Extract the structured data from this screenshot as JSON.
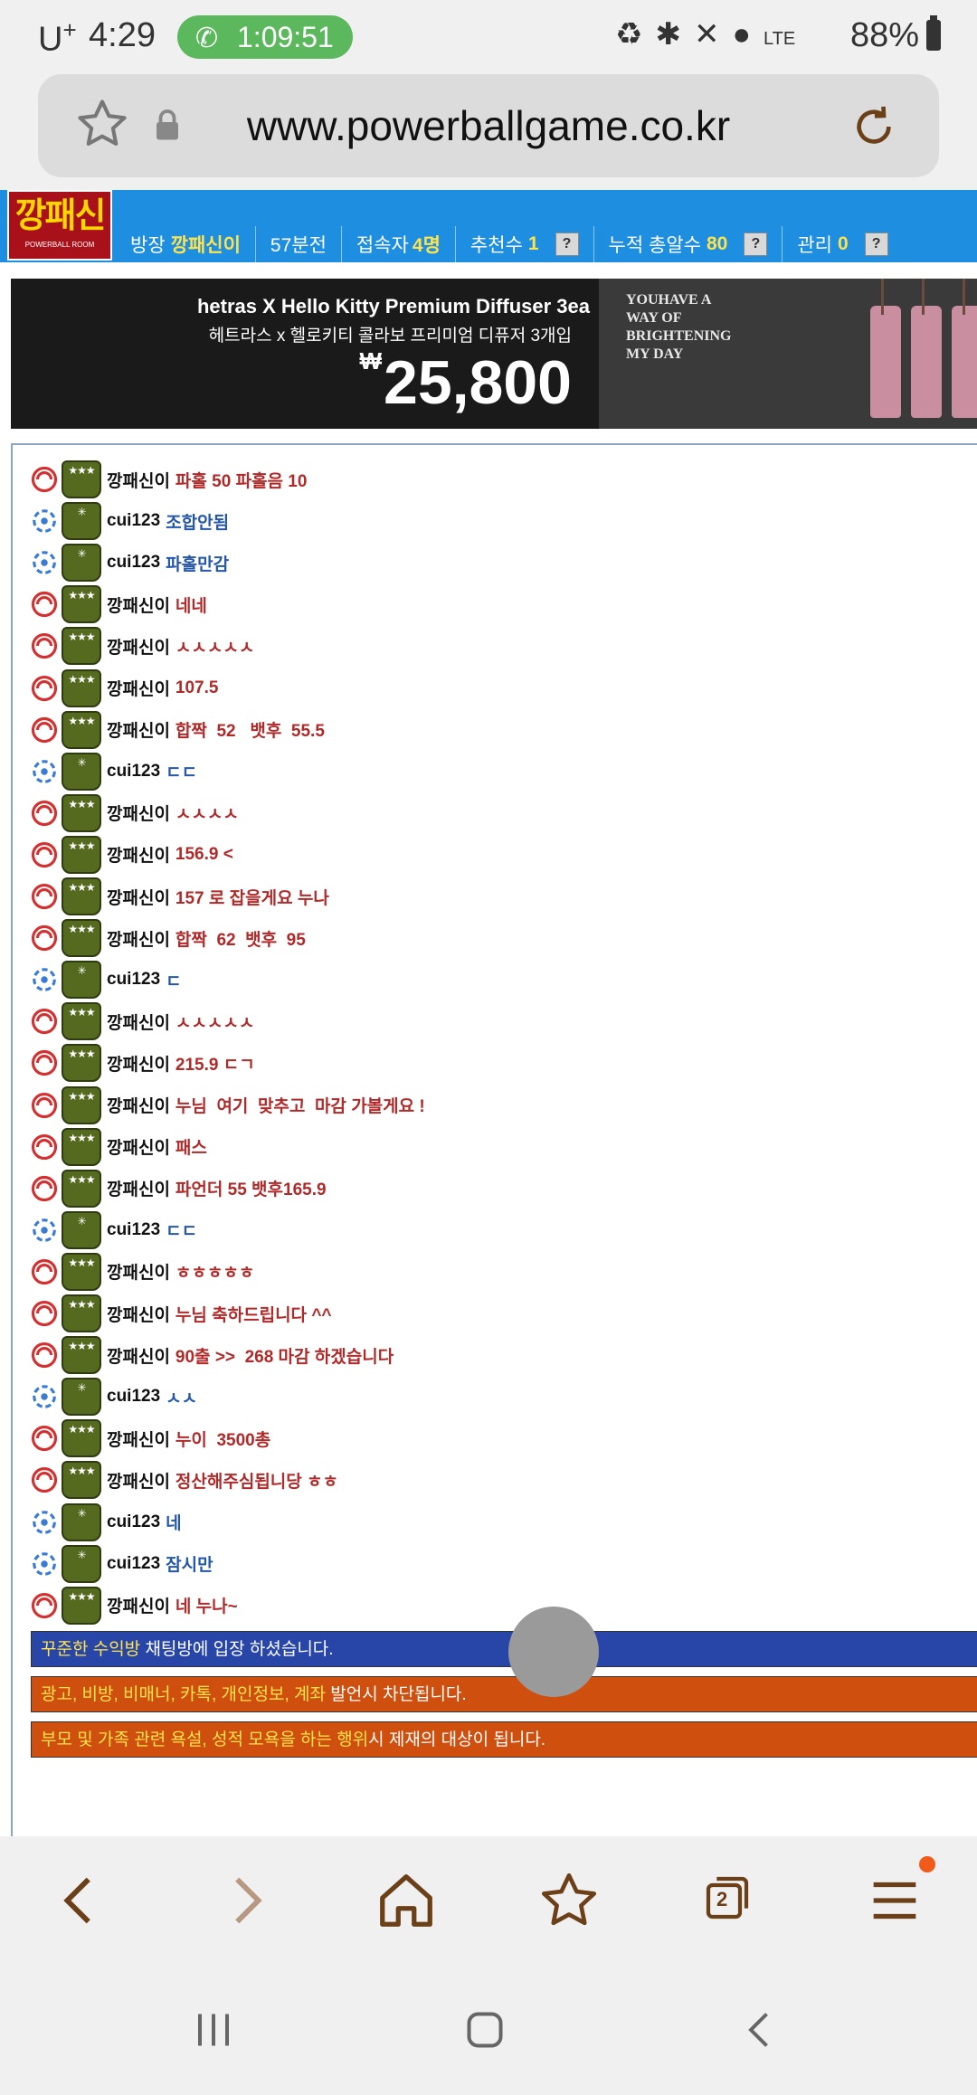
{
  "status_bar": {
    "carrier": "U",
    "carrier_sup": "+",
    "time": "4:29",
    "call_timer": "1:09:51",
    "network": "LTE",
    "battery": "88%"
  },
  "browser": {
    "url": "www.powerballgame.co.kr",
    "tab_count": "2"
  },
  "room": {
    "logo_text": "깡패신",
    "logo_sub": "POWERBALL ROOM",
    "owner_label": "방장",
    "owner_name": "깡패신이",
    "elapsed": "57분전",
    "visitors_label": "접속자",
    "visitors_value": "4명",
    "recommend_label": "추천수",
    "recommend_value": "1",
    "total_label": "누적 총알수",
    "total_value": "80",
    "manage_label": "관리",
    "manage_value": "0",
    "help_btn": "?"
  },
  "ad": {
    "title": "hetras X Hello Kitty Premium Diffuser 3ea",
    "subtitle": "헤트라스 x 헬로키티 콜라보 프리미엄 디퓨저 3개입",
    "currency": "₩",
    "price": "25,800",
    "card_text": "YOUHAVE A WAY OF BRIGHTENING MY DAY"
  },
  "messages": [
    {
      "user": "깡패신이",
      "text": "파홀 50 파홀음 10",
      "role": "owner"
    },
    {
      "user": "cui123",
      "text": "조합안됨",
      "role": "member"
    },
    {
      "user": "cui123",
      "text": "파홀만감",
      "role": "member"
    },
    {
      "user": "깡패신이",
      "text": "네네",
      "role": "owner"
    },
    {
      "user": "깡패신이",
      "text": "ㅅㅅㅅㅅㅅ",
      "role": "owner"
    },
    {
      "user": "깡패신이",
      "text": "107.5",
      "role": "owner"
    },
    {
      "user": "깡패신이",
      "text": "합짝  52   뱃후  55.5",
      "role": "owner"
    },
    {
      "user": "cui123",
      "text": "ㄷㄷ",
      "role": "member"
    },
    {
      "user": "깡패신이",
      "text": "ㅅㅅㅅㅅ",
      "role": "owner"
    },
    {
      "user": "깡패신이",
      "text": "156.9 <",
      "role": "owner"
    },
    {
      "user": "깡패신이",
      "text": "157 로 잡을게요 누나",
      "role": "owner"
    },
    {
      "user": "깡패신이",
      "text": "합짝  62  뱃후  95",
      "role": "owner"
    },
    {
      "user": "cui123",
      "text": "ㄷ",
      "role": "member"
    },
    {
      "user": "깡패신이",
      "text": "ㅅㅅㅅㅅㅅ",
      "role": "owner"
    },
    {
      "user": "깡패신이",
      "text": "215.9 ㄷㄱ",
      "role": "owner"
    },
    {
      "user": "깡패신이",
      "text": "누님  여기  맞추고  마감 가볼게요 !",
      "role": "owner"
    },
    {
      "user": "깡패신이",
      "text": "패스",
      "role": "owner"
    },
    {
      "user": "깡패신이",
      "text": "파언더 55 뱃후165.9",
      "role": "owner"
    },
    {
      "user": "cui123",
      "text": "ㄷㄷ",
      "role": "member"
    },
    {
      "user": "깡패신이",
      "text": "ㅎㅎㅎㅎㅎ",
      "role": "owner"
    },
    {
      "user": "깡패신이",
      "text": "누님 축하드립니다 ^^",
      "role": "owner"
    },
    {
      "user": "깡패신이",
      "text": "90출 >>  268 마감 하겠습니다",
      "role": "owner"
    },
    {
      "user": "cui123",
      "text": "ㅅㅅ",
      "role": "member"
    },
    {
      "user": "깡패신이",
      "text": "누이  3500총",
      "role": "owner"
    },
    {
      "user": "깡패신이",
      "text": "정산해주심됩니당 ㅎㅎ",
      "role": "owner"
    },
    {
      "user": "cui123",
      "text": "네",
      "role": "member"
    },
    {
      "user": "cui123",
      "text": "잠시만",
      "role": "member"
    },
    {
      "user": "깡패신이",
      "text": "네 누나~",
      "role": "owner"
    }
  ],
  "notices": [
    {
      "highlight": "꾸준한 수익방",
      "rest": " 채팅방에 입장 하셨습니다.",
      "color": "#2846a8"
    },
    {
      "highlight": "광고, 비방, 비매너, 카톡, 개인정보, 계좌",
      "rest": " 발언시 차단됩니다.",
      "color": "#cf4f0f"
    },
    {
      "highlight": "부모 및 가족 관련 욕설, 성적 모욕을 하는 행위",
      "rest": "시 제재의 대상이 됩니다.",
      "color": "#cf4f0f"
    }
  ],
  "avatar_badges": {
    "owner": "★★★",
    "member": "✳"
  },
  "icons": [
    "star-icon",
    "lock-icon",
    "reload-icon",
    "back-icon",
    "forward-icon",
    "home-icon",
    "bookmark-icon",
    "tabs-icon",
    "menu-icon",
    "recents-icon",
    "home-nav-icon",
    "back-nav-icon"
  ]
}
